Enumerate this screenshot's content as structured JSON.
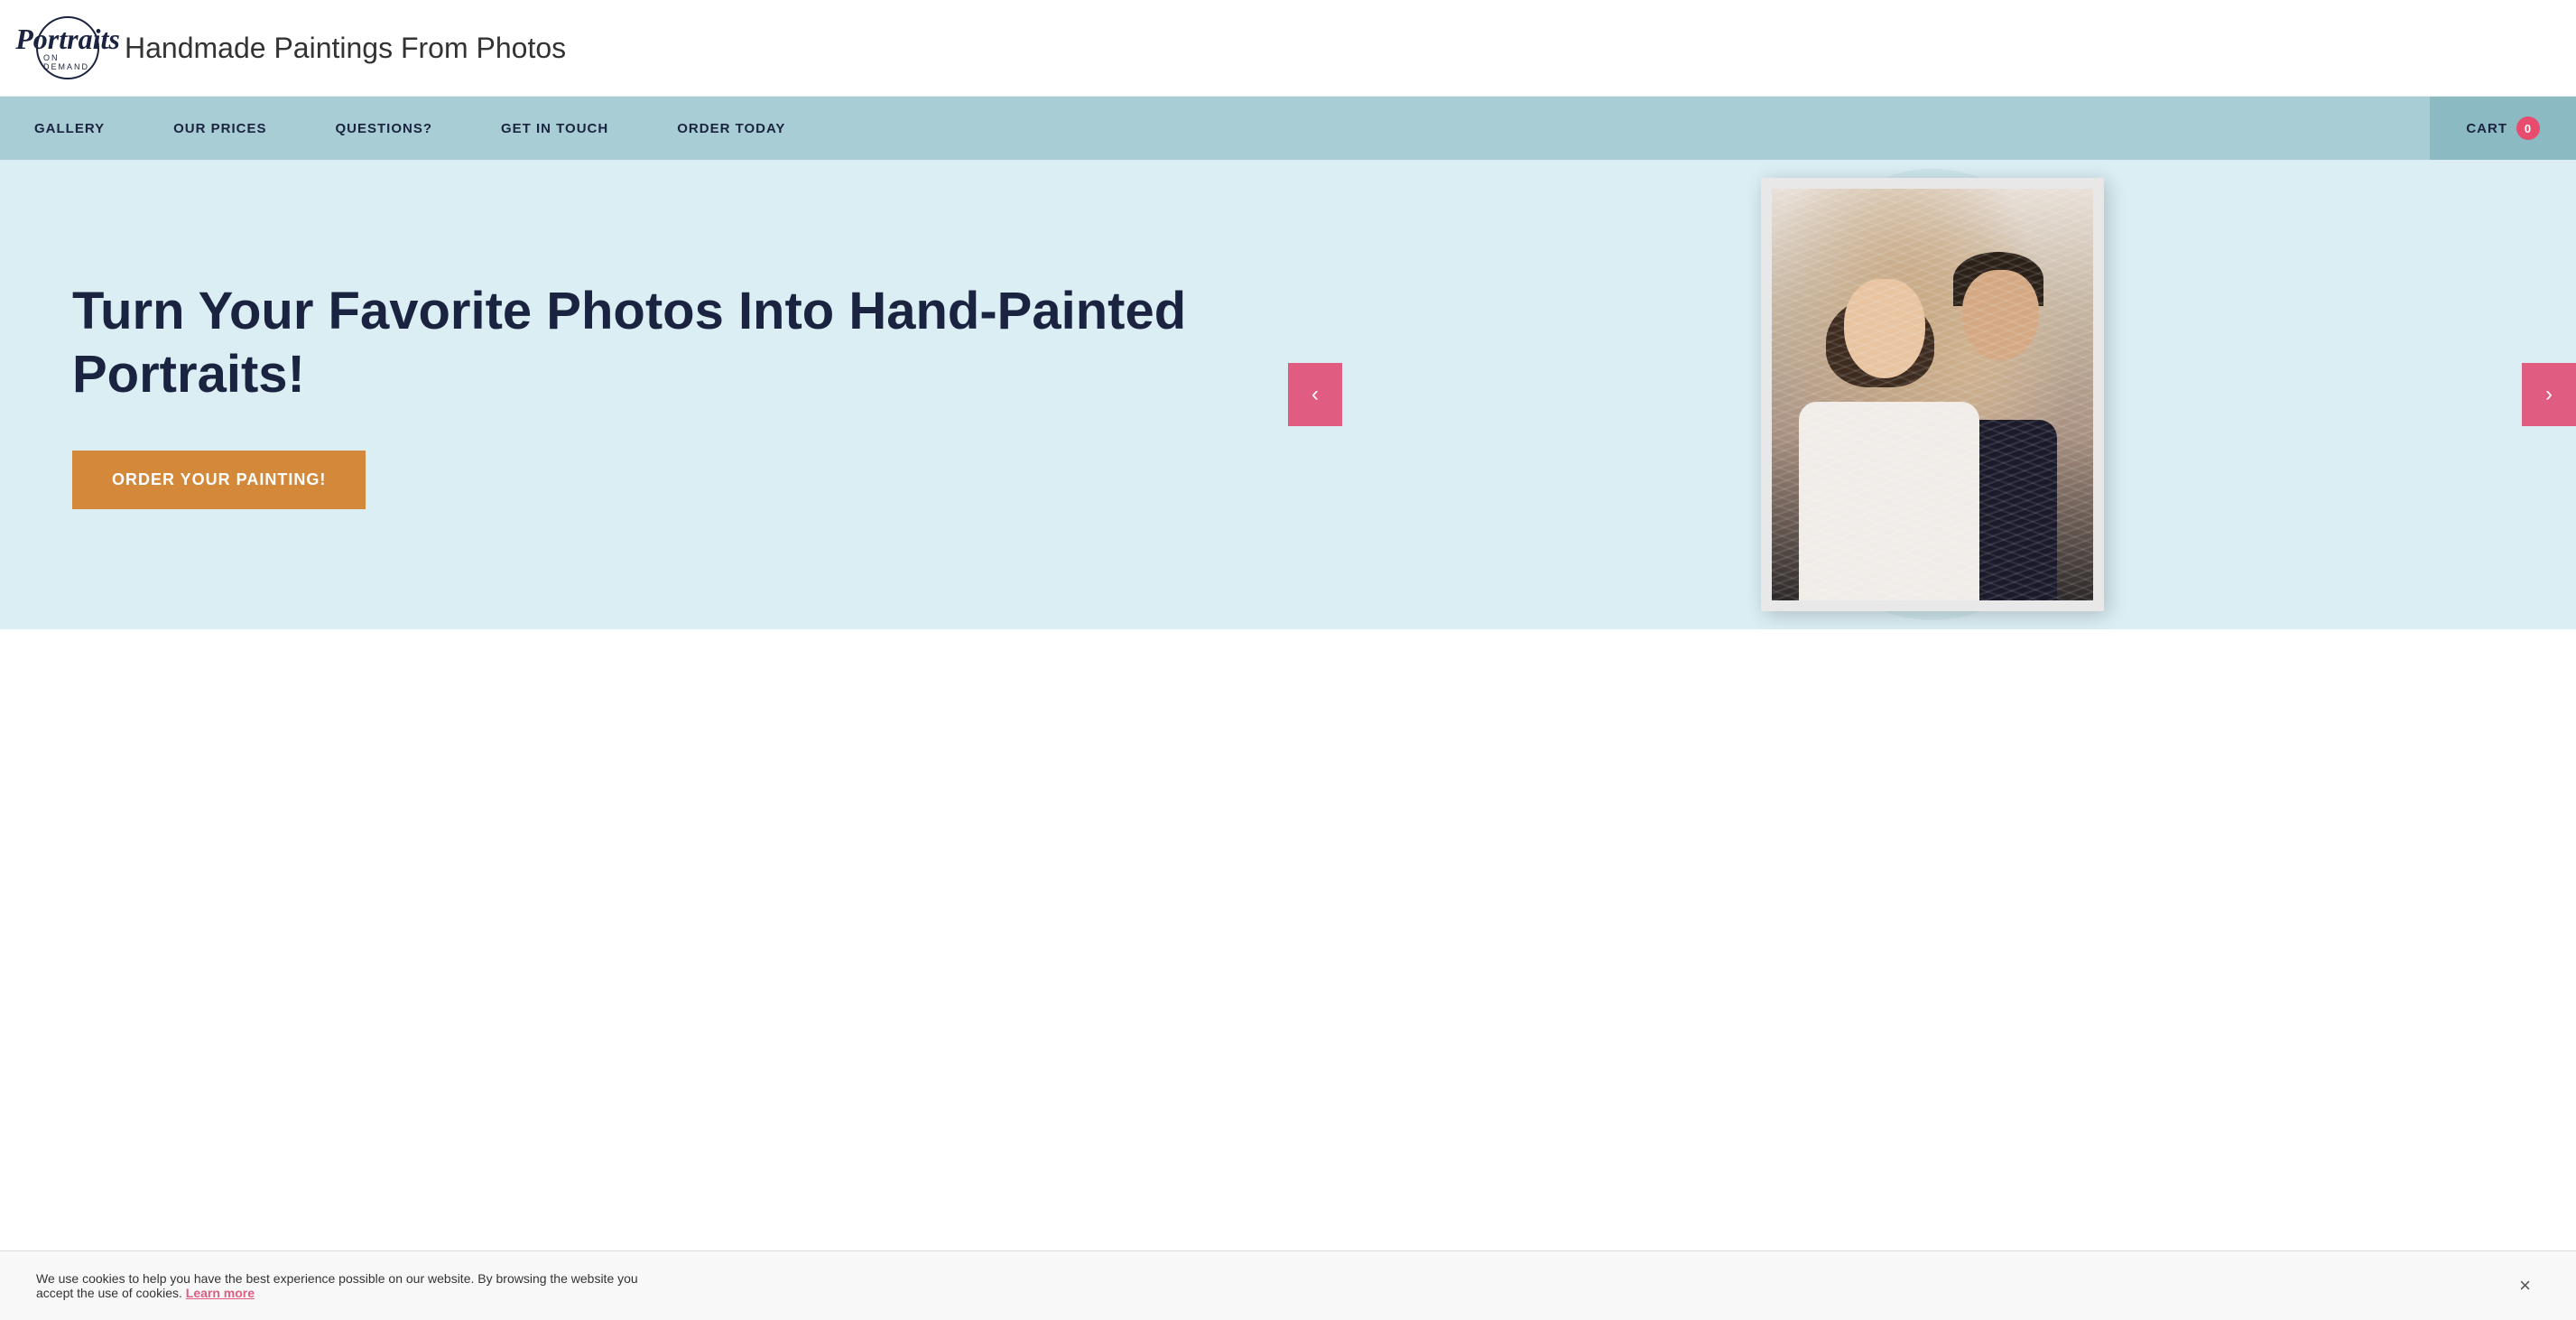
{
  "header": {
    "logo_script": "Portraits",
    "logo_sub": "ON DEMAND",
    "tagline": "Handmade Paintings From Photos"
  },
  "navbar": {
    "items": [
      {
        "id": "gallery",
        "label": "GALLERY"
      },
      {
        "id": "our-prices",
        "label": "OUR PRICES"
      },
      {
        "id": "questions",
        "label": "QUESTIONS?"
      },
      {
        "id": "get-in-touch",
        "label": "GET IN TOUCH"
      },
      {
        "id": "order-today",
        "label": "ORDER TODAY"
      }
    ],
    "cart": {
      "label": "CART",
      "count": "0"
    }
  },
  "hero": {
    "title": "Turn Your Favorite Photos Into Hand-Painted Portraits!",
    "cta_button": "ORDER YOUR PAINTING!",
    "arrow_left": "‹",
    "arrow_right": "›"
  },
  "cookie": {
    "text": "We use cookies to help you have the best experience possible on our website. By browsing the website you accept the use of cookies.",
    "link_text": "Learn more",
    "close": "×"
  }
}
